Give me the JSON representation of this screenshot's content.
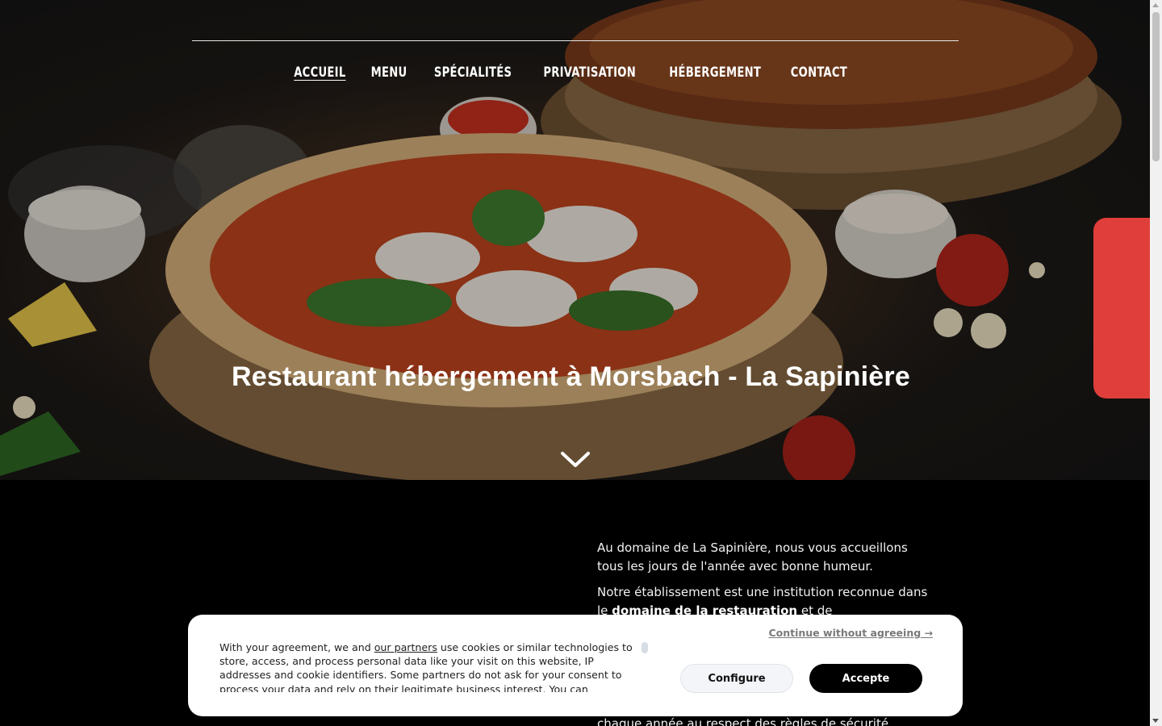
{
  "nav": {
    "items": [
      "ACCUEIL",
      "MENU",
      "SPÉCIALITÉS",
      "PRIVATISATION",
      "HÉBERGEMENT",
      "CONTACT"
    ],
    "active": "ACCUEIL"
  },
  "hero": {
    "title": "Restaurant hébergement à Morsbach - La Sapinière"
  },
  "content": {
    "p1": "Au domaine de La Sapinière, nous vous accueillons tous les jours de l'année avec bonne humeur.",
    "p2_before": "Notre établissement est une institution reconnue dans le ",
    "p2_bold": "domaine de la restauration",
    "p2_after": " et de",
    "p3": "chaque année au respect des règles de sécurité"
  },
  "cookie": {
    "text_before": "With your agreement, we and ",
    "partners_link": "our partners",
    "text_after": " use cookies or similar technologies to store, access, and process personal data like your visit on this website, IP addresses and cookie identifiers. Some partners do not ask for your consent to process your data and rely on their legitimate business interest. You can",
    "continue_label": "Continue without agreeing →",
    "configure_label": "Configure",
    "accept_label": "Accepte"
  },
  "colors": {
    "side_tab": "#e03e3a",
    "accept_bg": "#000000"
  }
}
